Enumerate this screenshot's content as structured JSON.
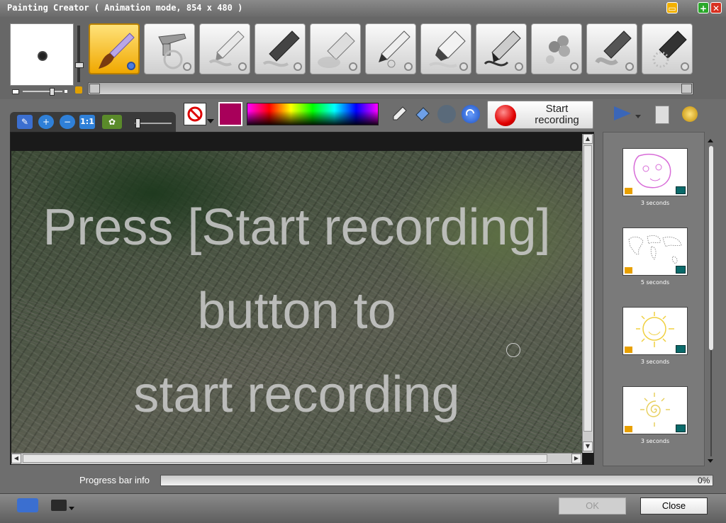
{
  "window": {
    "title": "Painting Creator ( Animation mode, 854 x 480 )",
    "minimize_glyph": "▭",
    "maximize_glyph": "+",
    "close_glyph": "✕"
  },
  "tools": [
    {
      "icon": "paint-brush-icon",
      "active": true
    },
    {
      "icon": "airbrush-icon",
      "active": false
    },
    {
      "icon": "crayon-icon",
      "active": false
    },
    {
      "icon": "marker-icon",
      "active": false
    },
    {
      "icon": "chalk-icon",
      "active": false
    },
    {
      "icon": "pencil-icon",
      "active": false
    },
    {
      "icon": "felt-pen-icon",
      "active": false
    },
    {
      "icon": "ink-pen-icon",
      "active": false
    },
    {
      "icon": "stamp-flower-icon",
      "active": false
    },
    {
      "icon": "calligraphy-pen-icon",
      "active": false
    },
    {
      "icon": "spray-pen-icon",
      "active": false
    }
  ],
  "view_tools": {
    "actual_size_label": "1:1"
  },
  "colors": {
    "current": "#a8005a",
    "accent": "#f0a800"
  },
  "record": {
    "label_line1": "Start",
    "label_line2": "recording"
  },
  "canvas": {
    "overlay_lines": [
      "Press [Start recording]",
      "button to",
      "start recording"
    ]
  },
  "frames": [
    {
      "label": "3 seconds",
      "content": "face"
    },
    {
      "label": "5 seconds",
      "content": "world-map"
    },
    {
      "label": "3 seconds",
      "content": "sun-face"
    },
    {
      "label": "3 seconds",
      "content": "spiral-sun"
    }
  ],
  "progress": {
    "label": "Progress bar info",
    "value_text": "0%",
    "value": 0
  },
  "buttons": {
    "ok": "OK",
    "close": "Close"
  }
}
